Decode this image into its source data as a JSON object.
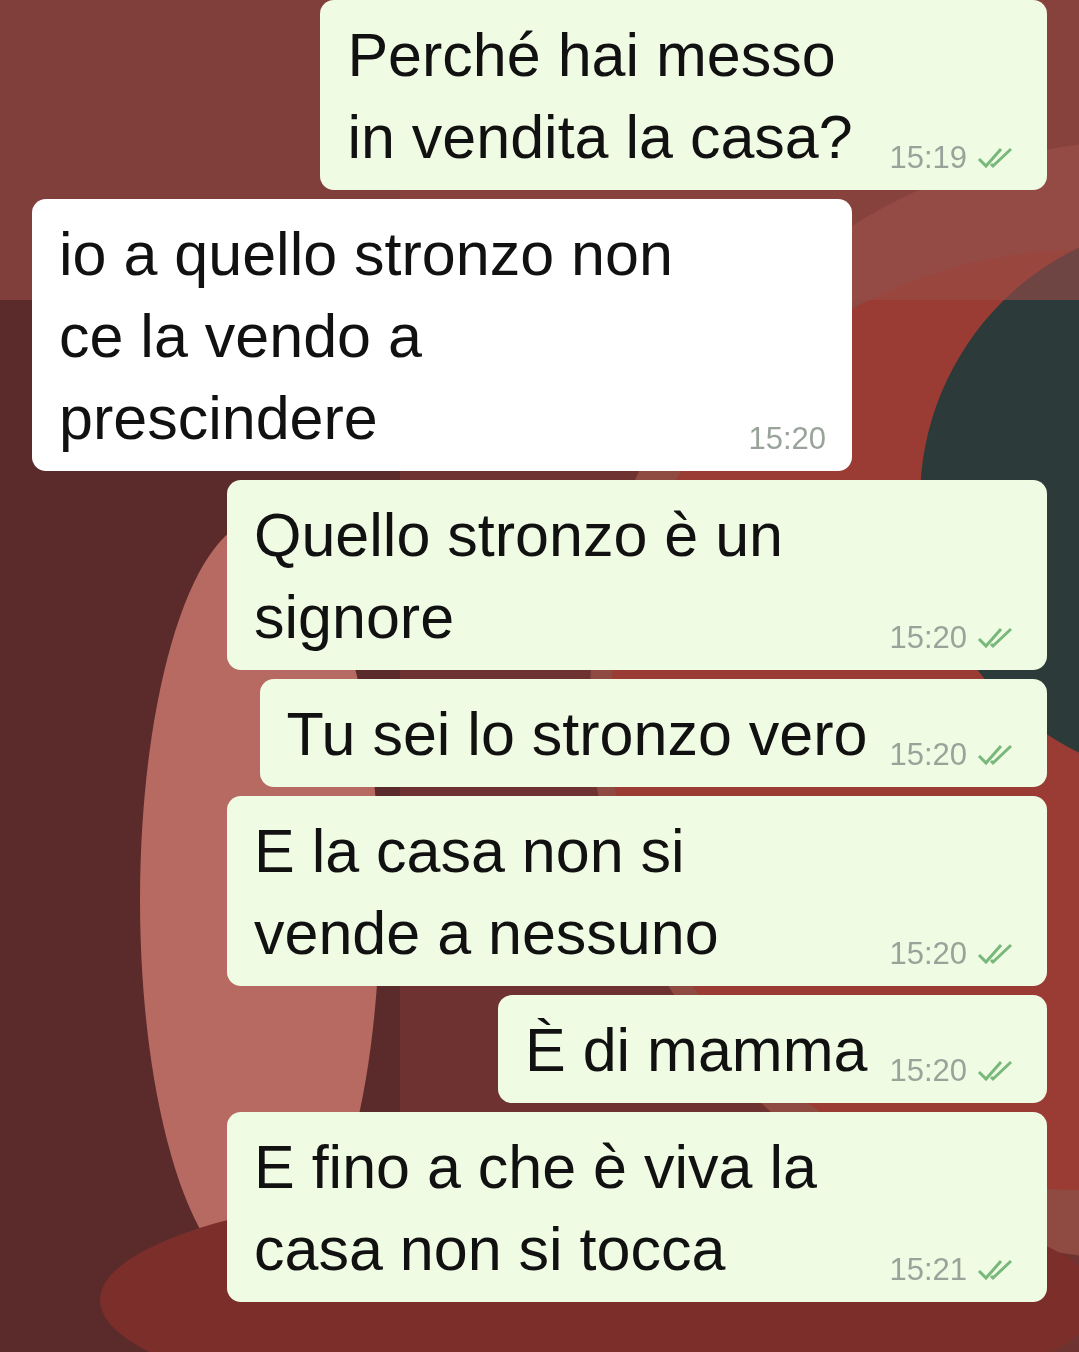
{
  "messages": [
    {
      "kind": "outgoing",
      "text": "Perché hai messo in vendita la casa?",
      "time": "15:19"
    },
    {
      "kind": "incoming",
      "text": "io a quello stronzo non ce la vendo a prescindere",
      "time": "15:20"
    },
    {
      "kind": "outgoing",
      "text": "Quello stronzo è un signore",
      "time": "15:20"
    },
    {
      "kind": "outgoing",
      "text": "Tu sei lo stronzo vero",
      "time": "15:20"
    },
    {
      "kind": "outgoing",
      "text": "E la casa non si vende a nessuno",
      "time": "15:20"
    },
    {
      "kind": "outgoing",
      "text": "È di mamma",
      "time": "15:20"
    },
    {
      "kind": "outgoing",
      "text": "E fino a che è viva la casa non si tocca",
      "time": "15:21"
    }
  ]
}
